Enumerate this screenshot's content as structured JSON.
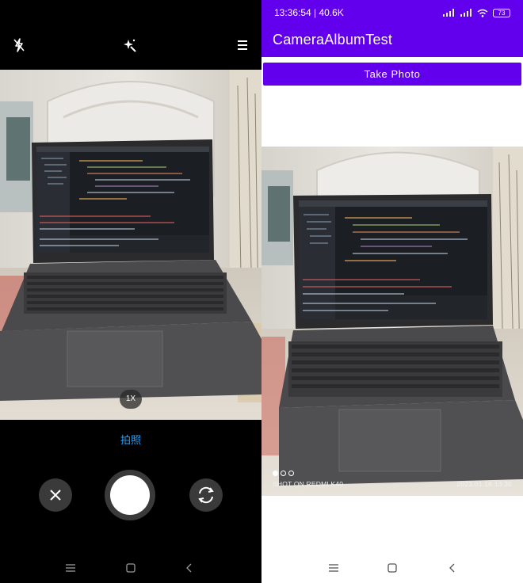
{
  "camera": {
    "top_icons": [
      "flash-off-icon",
      "magic-wand-icon",
      "menu-icon"
    ],
    "zoom_label": "1X",
    "mode_label": "拍照",
    "controls": [
      "close-icon",
      "shutter-button",
      "switch-camera-icon"
    ]
  },
  "app": {
    "status": {
      "time_speed": "13:36:54 | 40.6K",
      "battery": "73",
      "icons": [
        "sim-icon",
        "nfc-icon",
        "font-icon",
        "signal-icon",
        "signal-icon",
        "wifi-icon",
        "battery-icon"
      ]
    },
    "title": "CameraAlbumTest",
    "take_photo_label": "Take Photo",
    "photo": {
      "watermark_left": "SHOT ON REDMI K40",
      "watermark_right": "2023.01.16   13:36"
    }
  },
  "navbar": {
    "icons": [
      "recents-icon",
      "home-icon",
      "back-icon"
    ]
  },
  "colors": {
    "primary": "#6200ee",
    "camera_mode_accent": "#1fa3ff",
    "camera_background": "#000000"
  }
}
